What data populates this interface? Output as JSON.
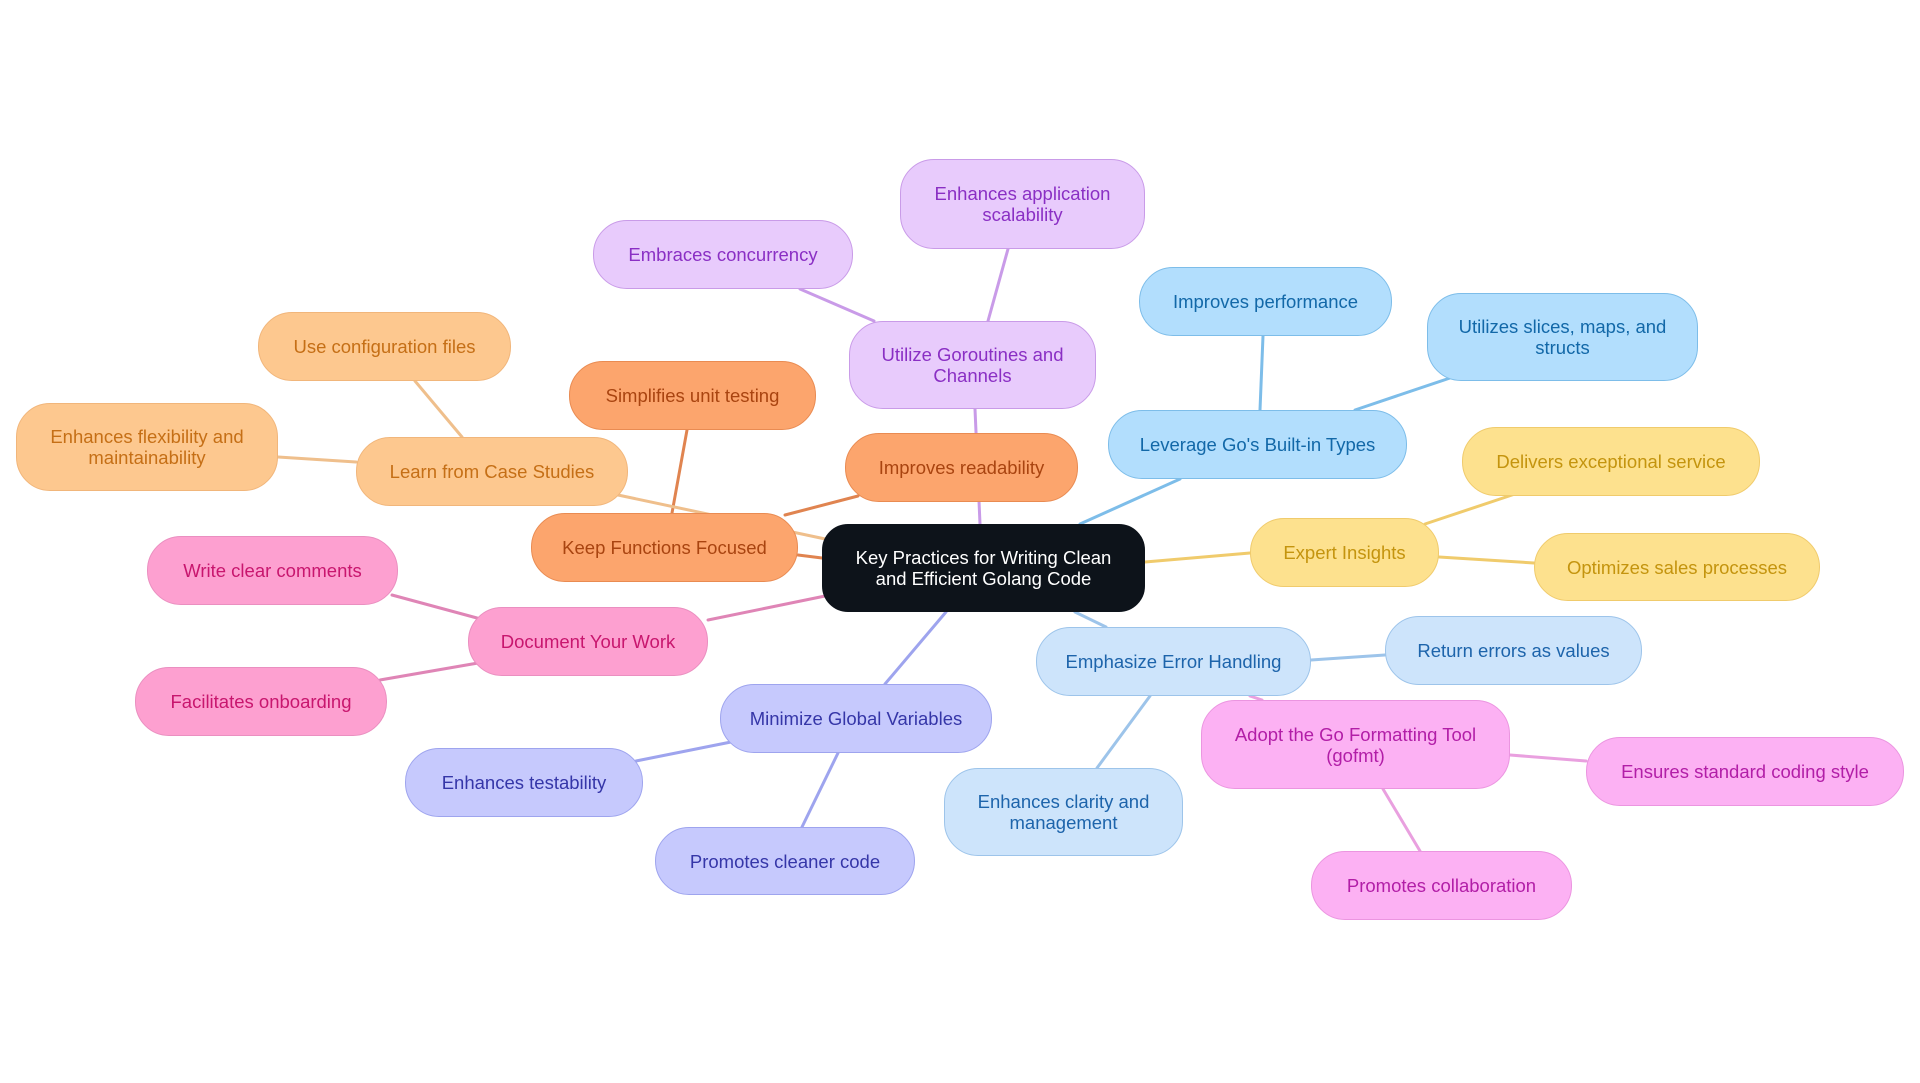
{
  "title": "Key Practices for Writing Clean and Efficient Golang Code",
  "palette": {
    "root": {
      "fill": "#0d131a",
      "stroke": "#0d131a",
      "text": "#ffffff"
    },
    "purple": {
      "fill": "#e8cbfc",
      "stroke": "#c99be8",
      "text": "#8a2fc4",
      "edge": "#c99be8"
    },
    "blue": {
      "fill": "#b2defd",
      "stroke": "#7dbde9",
      "text": "#1268a8",
      "edge": "#7dbde9"
    },
    "yellow": {
      "fill": "#fde18e",
      "stroke": "#f0cb6c",
      "text": "#c4940e",
      "edge": "#f0cb6c"
    },
    "orange": {
      "fill": "#fca56d",
      "stroke": "#e98b52",
      "text": "#a94410",
      "edge": "#e08450"
    },
    "peach": {
      "fill": "#fdc88f",
      "stroke": "#f1b67b",
      "text": "#c56f16",
      "edge": "#efbf8c"
    },
    "pink": {
      "fill": "#fda0d0",
      "stroke": "#ea8fc0",
      "text": "#c8166e",
      "edge": "#df85b6"
    },
    "indigo": {
      "fill": "#c6c9fd",
      "stroke": "#9ea4ee",
      "text": "#3536a8",
      "edge": "#9ea4ee"
    },
    "lightblue": {
      "fill": "#cde4fb",
      "stroke": "#9dc4ea",
      "text": "#1d64ab",
      "edge": "#9dc4ea"
    },
    "magenta": {
      "fill": "#fcb1f3",
      "stroke": "#eb95e0",
      "text": "#b21ea7",
      "edge": "#e9a0df"
    }
  },
  "nodes": [
    {
      "id": "root",
      "label": "Key Practices for Writing Clean and Efficient Golang Code",
      "color": "root"
    },
    {
      "id": "goroutines",
      "label": "Utilize Goroutines and Channels",
      "color": "purple",
      "parent": "root"
    },
    {
      "id": "scalability",
      "label": "Enhances application scalability",
      "color": "purple",
      "parent": "goroutines"
    },
    {
      "id": "concurrency",
      "label": "Embraces concurrency",
      "color": "purple",
      "parent": "goroutines"
    },
    {
      "id": "builtin",
      "label": "Leverage Go's Built-in Types",
      "color": "blue",
      "parent": "root"
    },
    {
      "id": "performance",
      "label": "Improves performance",
      "color": "blue",
      "parent": "builtin"
    },
    {
      "id": "slices",
      "label": "Utilizes slices, maps, and structs",
      "color": "blue",
      "parent": "builtin"
    },
    {
      "id": "expert",
      "label": "Expert Insights",
      "color": "yellow",
      "parent": "root"
    },
    {
      "id": "service",
      "label": "Delivers exceptional service",
      "color": "yellow",
      "parent": "expert"
    },
    {
      "id": "sales",
      "label": "Optimizes sales processes",
      "color": "yellow",
      "parent": "expert"
    },
    {
      "id": "focused",
      "label": "Keep Functions Focused",
      "color": "orange",
      "parent": "root"
    },
    {
      "id": "readability",
      "label": "Improves readability",
      "color": "orange",
      "parent": "focused"
    },
    {
      "id": "unittest",
      "label": "Simplifies unit testing",
      "color": "orange",
      "parent": "focused"
    },
    {
      "id": "casestudies",
      "label": "Learn from Case Studies",
      "color": "peach",
      "parent": "root"
    },
    {
      "id": "config",
      "label": "Use configuration files",
      "color": "peach",
      "parent": "casestudies"
    },
    {
      "id": "flexibility",
      "label": "Enhances flexibility and maintainability",
      "color": "peach",
      "parent": "casestudies"
    },
    {
      "id": "document",
      "label": "Document Your Work",
      "color": "pink",
      "parent": "root"
    },
    {
      "id": "comments",
      "label": "Write clear comments",
      "color": "pink",
      "parent": "document"
    },
    {
      "id": "onboarding",
      "label": "Facilitates onboarding",
      "color": "pink",
      "parent": "document"
    },
    {
      "id": "globals",
      "label": "Minimize Global Variables",
      "color": "indigo",
      "parent": "root"
    },
    {
      "id": "testability",
      "label": "Enhances testability",
      "color": "indigo",
      "parent": "globals"
    },
    {
      "id": "cleaner",
      "label": "Promotes cleaner code",
      "color": "indigo",
      "parent": "globals"
    },
    {
      "id": "errors",
      "label": "Emphasize Error Handling",
      "color": "lightblue",
      "parent": "root"
    },
    {
      "id": "values",
      "label": "Return errors as values",
      "color": "lightblue",
      "parent": "errors"
    },
    {
      "id": "clarity",
      "label": "Enhances clarity and management",
      "color": "lightblue",
      "parent": "errors"
    },
    {
      "id": "gofmt",
      "label": "Adopt the Go Formatting Tool (gofmt)",
      "color": "magenta",
      "parent": "root"
    },
    {
      "id": "style",
      "label": "Ensures standard coding style",
      "color": "magenta",
      "parent": "gofmt"
    },
    {
      "id": "collab",
      "label": "Promotes collaboration",
      "color": "magenta",
      "parent": "gofmt"
    }
  ]
}
